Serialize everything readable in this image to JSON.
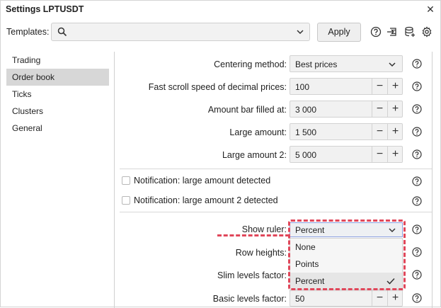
{
  "window": {
    "title": "Settings LPTUSDT"
  },
  "templates": {
    "label": "Templates:",
    "search_value": "",
    "apply_label": "Apply"
  },
  "toolbar_icons": [
    "help-icon",
    "import-icon",
    "database-add-icon",
    "gear-icon"
  ],
  "nav": {
    "items": [
      {
        "label": "Trading",
        "active": false
      },
      {
        "label": "Order book",
        "active": true
      },
      {
        "label": "Ticks",
        "active": false
      },
      {
        "label": "Clusters",
        "active": false
      },
      {
        "label": "General",
        "active": false
      }
    ]
  },
  "settings": {
    "centering_method": {
      "label": "Centering method:",
      "value": "Best prices"
    },
    "fast_scroll": {
      "label": "Fast scroll speed of decimal prices:",
      "value": "100"
    },
    "amount_bar": {
      "label": "Amount bar filled at:",
      "value": "3 000"
    },
    "large_amount": {
      "label": "Large amount:",
      "value": "1 500"
    },
    "large_amount_2": {
      "label": "Large amount 2:",
      "value": "5 000"
    },
    "notif_large": {
      "label": "Notification: large amount detected",
      "checked": false
    },
    "notif_large_2": {
      "label": "Notification: large amount 2 detected",
      "checked": false
    },
    "show_ruler": {
      "label": "Show ruler:",
      "value": "Percent",
      "options": [
        "None",
        "Points",
        "Percent"
      ],
      "selected": "Percent"
    },
    "row_heights": {
      "label": "Row heights:"
    },
    "slim_levels": {
      "label": "Slim levels factor:"
    },
    "basic_levels": {
      "label": "Basic levels factor:",
      "value": "50"
    }
  },
  "colors": {
    "annotation": "#e0475a",
    "nav_active": "#d7d7d7",
    "field_bg": "#f1f1f1"
  }
}
